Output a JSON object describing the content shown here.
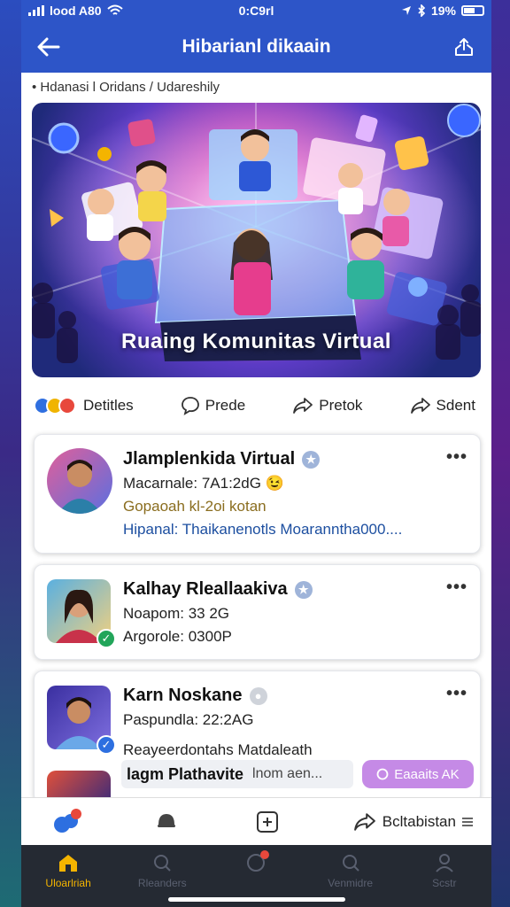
{
  "status_bar": {
    "carrier": "lood A80",
    "time": "0:C9rl",
    "battery": "19%"
  },
  "app_bar": {
    "title": "Hibarianl dikaain"
  },
  "breadcrumb": "• Hdanasi l Oridans / Udareshily",
  "banner": {
    "title": "Ruaing Komunitas Virtual"
  },
  "actions": [
    {
      "label": "Detitles",
      "icon": "reactions-icon"
    },
    {
      "label": "Prede",
      "icon": "comment-icon"
    },
    {
      "label": "Pretok",
      "icon": "share-icon"
    },
    {
      "label": "Sdent",
      "icon": "send-icon"
    }
  ],
  "cards": [
    {
      "name": "Jlamplenkida Virtual",
      "line1": "Macarnale: 7A1:2dG",
      "emoji": "😉",
      "line2": "Gopaoah kl-2oi kotan",
      "line3": "Hipanal: Thaikanenotls Moaranntha000...."
    },
    {
      "name": "Kalhay Rleallaakiva",
      "line1": "Noapom: 33 2G",
      "line2": "Argorole: 0300P"
    },
    {
      "name": "Karn Noskane",
      "line1": "Paspundla: 22:2AG",
      "line2": "Reayeerdontahs Matdaleath"
    }
  ],
  "partial_row": {
    "name": "lagm Plathavite",
    "subtext": "lnom aen...",
    "button": "Eaaaits AK"
  },
  "action_nav": {
    "share_label": "Bcltabistan"
  },
  "tabs": [
    {
      "label": "Uloarlriah",
      "icon": "home-icon",
      "active": true
    },
    {
      "label": "Rleanders",
      "icon": "search-icon",
      "active": false
    },
    {
      "label": "",
      "icon": "notification-icon",
      "active": false
    },
    {
      "label": "Venmidre",
      "icon": "search-icon",
      "active": false
    },
    {
      "label": "Scstr",
      "icon": "profile-icon",
      "active": false
    }
  ],
  "colors": {
    "primary": "#2d55c8",
    "link": "#1d4fa0",
    "gold": "#8a6d1f",
    "tab_active": "#f4b400"
  }
}
